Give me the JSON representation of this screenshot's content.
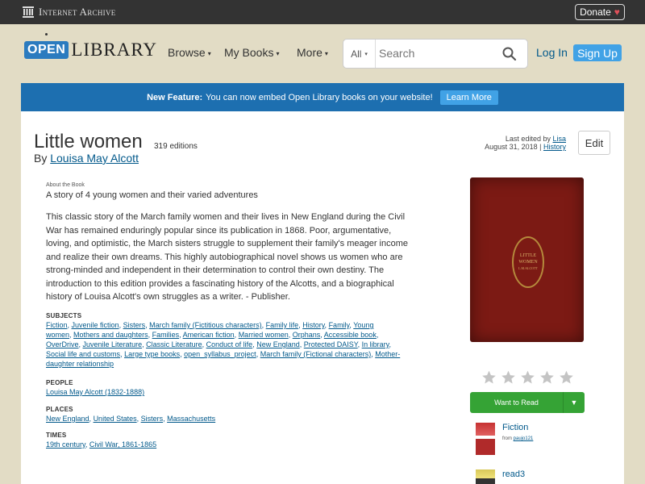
{
  "topbar": {
    "org_name": "Internet Archive",
    "donate_label": "Donate",
    "donate_icon": "heart-icon"
  },
  "header": {
    "logo_open": "OPEN",
    "logo_library": "LIBRARY",
    "nav": [
      {
        "label": "Browse"
      },
      {
        "label": "My Books"
      },
      {
        "label": "More"
      }
    ],
    "search": {
      "scope": "All",
      "placeholder": "Search"
    },
    "login_label": "Log In",
    "signup_label": "Sign Up"
  },
  "banner": {
    "heading": "New Feature:",
    "message": "You can now embed Open Library books on your website!",
    "button_label": "Learn More"
  },
  "book": {
    "title": "Little women",
    "editions": "319 editions",
    "by_prefix": "By",
    "author": "Louisa May Alcott",
    "last_edited_prefix": "Last edited by",
    "last_edited_user": "Lisa",
    "last_edited_date": "August 31, 2018",
    "history_label": "History",
    "edit_label": "Edit",
    "about_label": "About the Book",
    "summary": "A story of 4 young women and their varied adventures",
    "description": "This classic story of the March family women and their lives in New England during the Civil War has remained enduringly popular since its publication in 1868. Poor, argumentative, loving, and optimistic, the March sisters struggle to supplement their family's meager income and realize their own dreams. This highly autobiographical novel shows us women who are strong-minded and independent in their determination to control their own destiny. The introduction to this edition provides a fascinating history of the Alcotts, and a biographical history of Louisa Alcott's own struggles as a writer. - Publisher."
  },
  "subjects": {
    "label": "SUBJECTS",
    "items": [
      "Fiction",
      "Juvenile fiction",
      "Sisters",
      "March family (Fictitious characters)",
      "Family life",
      "History",
      "Family",
      "Young women",
      "Mothers and daughters",
      "Families",
      "American fiction",
      "Married women",
      "Orphans",
      "Accessible book",
      "OverDrive",
      "Juvenile Literature",
      "Classic Literature",
      "Conduct of life",
      "New England",
      "Protected DAISY",
      "In library",
      "Social life and customs",
      "Large type books",
      "open_syllabus_project",
      "March family (Fictional characters)",
      "Mother-daughter relationship"
    ]
  },
  "people": {
    "label": "PEOPLE",
    "items": [
      "Louisa May Alcott (1832-1888)"
    ]
  },
  "places": {
    "label": "PLACES",
    "items": [
      "New England",
      "United States",
      "Sisters",
      "Massachusetts"
    ]
  },
  "times": {
    "label": "TIMES",
    "items": [
      "19th century",
      "Civil War, 1861-1865"
    ]
  },
  "sidebar": {
    "cover_title_line1": "LITTLE",
    "cover_title_line2": "WOMEN",
    "cover_author": "L.M.ALCOTT",
    "rating_stars": 5,
    "rating_filled": 0,
    "want_to_read_label": "Want to Read",
    "lists": [
      {
        "name": "Fiction",
        "from_prefix": "from",
        "from_user": "paujo121"
      },
      {
        "name": "read3",
        "from_prefix": "",
        "from_user": ""
      }
    ]
  },
  "colors": {
    "page_bg": "#e2dcc5",
    "topbar_bg": "#333333",
    "banner_bg": "#1d6fb0",
    "link": "#02598b",
    "want_to_read": "#35a335",
    "cover": "#7c1a14"
  }
}
